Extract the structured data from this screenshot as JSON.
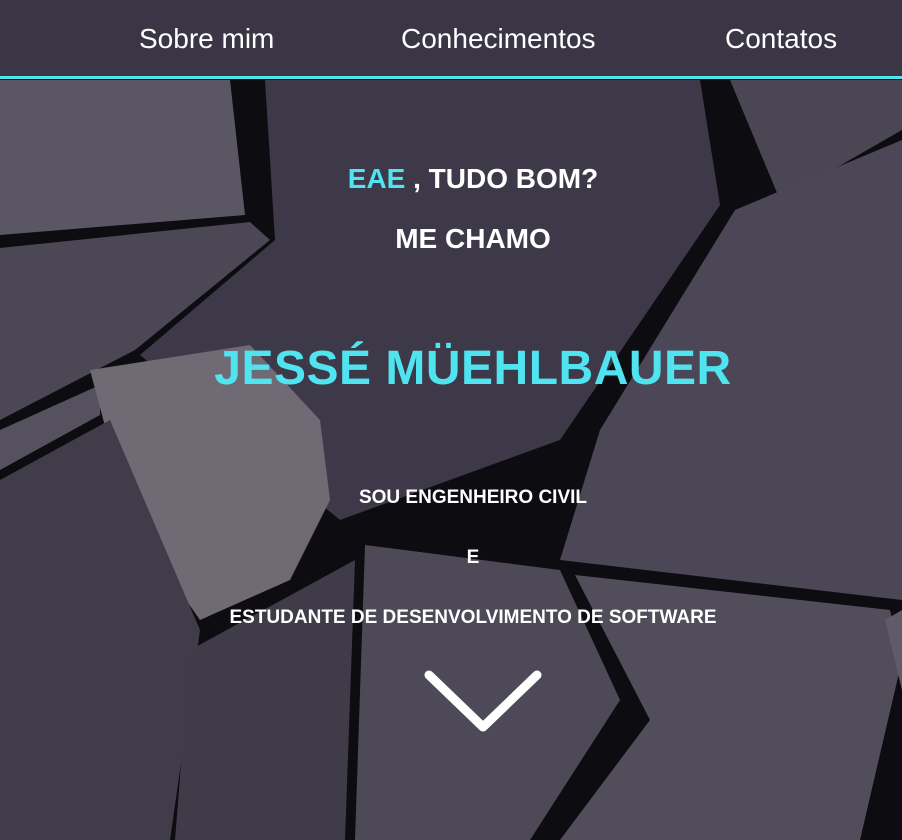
{
  "nav": {
    "items": [
      {
        "label": "Sobre mim"
      },
      {
        "label": "Conhecimentos"
      },
      {
        "label": "Contatos"
      }
    ]
  },
  "hero": {
    "greeting_accent": "EAE",
    "greeting_rest": " , TUDO BOM?",
    "intro": "ME CHAMO",
    "name": "JESSÉ MÜEHLBAUER",
    "line_1": "SOU ENGENHEIRO CIVIL",
    "line_2": "E",
    "line_3": "ESTUDANTE DE DESENVOLVIMENTO DE SOFTWARE",
    "scroll_icon": "chevron-down-icon"
  },
  "colors": {
    "accent": "#4fe4f0",
    "navbar": "#3b3645",
    "background": "#2b2833",
    "text": "#ffffff"
  }
}
